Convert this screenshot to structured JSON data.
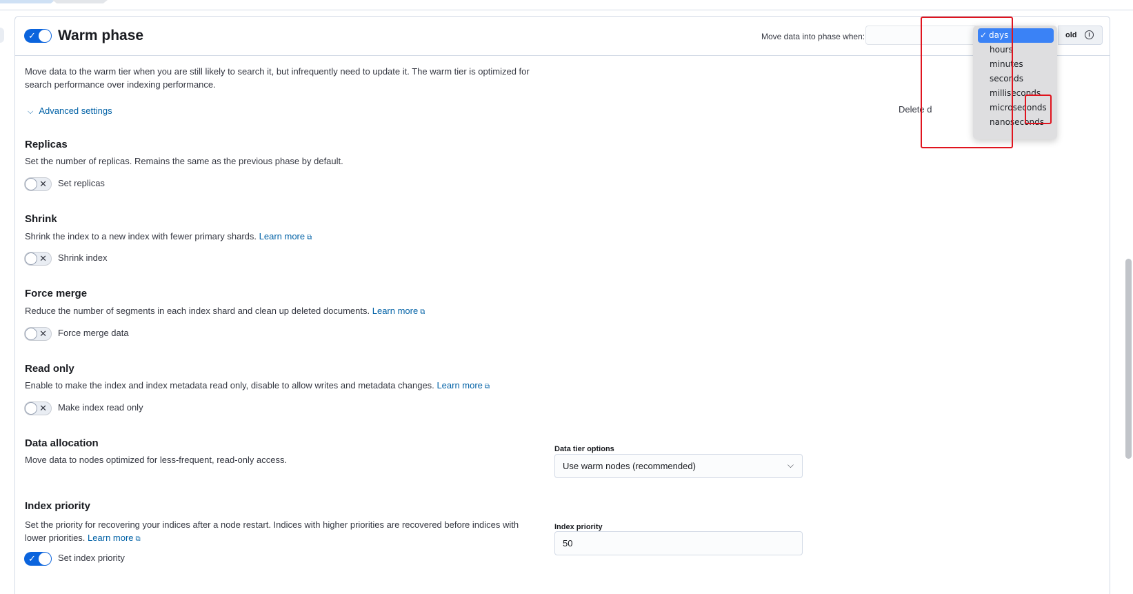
{
  "phase": {
    "title": "Warm phase",
    "enabled": true,
    "move_label": "Move data into phase when:",
    "old_label": "old",
    "description": "Move data to the warm tier when you are still likely to search it, but infrequently need to update it. The warm tier is optimized for search performance over indexing performance.",
    "advanced_label": "Advanced settings",
    "delete_label": "Delete d"
  },
  "units_dropdown": {
    "selected": "days",
    "options": [
      "days",
      "hours",
      "minutes",
      "seconds",
      "milliseconds",
      "microseconds",
      "nanoseconds"
    ]
  },
  "sections": {
    "replicas": {
      "title": "Replicas",
      "description": "Set the number of replicas. Remains the same as the previous phase by default.",
      "switch_label": "Set replicas",
      "switch_on": false
    },
    "shrink": {
      "title": "Shrink",
      "description": "Shrink the index to a new index with fewer primary shards.",
      "link": "Learn more",
      "switch_label": "Shrink index",
      "switch_on": false
    },
    "forcemerge": {
      "title": "Force merge",
      "description": "Reduce the number of segments in each index shard and clean up deleted documents.",
      "link": "Learn more",
      "switch_label": "Force merge data",
      "switch_on": false
    },
    "readonly": {
      "title": "Read only",
      "description": "Enable to make the index and index metadata read only, disable to allow writes and metadata changes.",
      "link": "Learn more",
      "switch_label": "Make index read only",
      "switch_on": false
    },
    "allocation": {
      "title": "Data allocation",
      "description": "Move data to nodes optimized for less-frequent, read-only access.",
      "field_label": "Data tier options",
      "select_value": "Use warm nodes (recommended)"
    },
    "priority": {
      "title": "Index priority",
      "description": "Set the priority for recovering your indices after a node restart. Indices with higher priorities are recovered before indices with lower priorities.",
      "link": "Learn more",
      "switch_label": "Set index priority",
      "switch_on": true,
      "field_label": "Index priority",
      "value": "50"
    }
  },
  "colors": {
    "accent": "#0b64dd",
    "link": "#0061a6",
    "highlight_box": "#e0141e",
    "dropdown_selected": "#3a82f6"
  }
}
